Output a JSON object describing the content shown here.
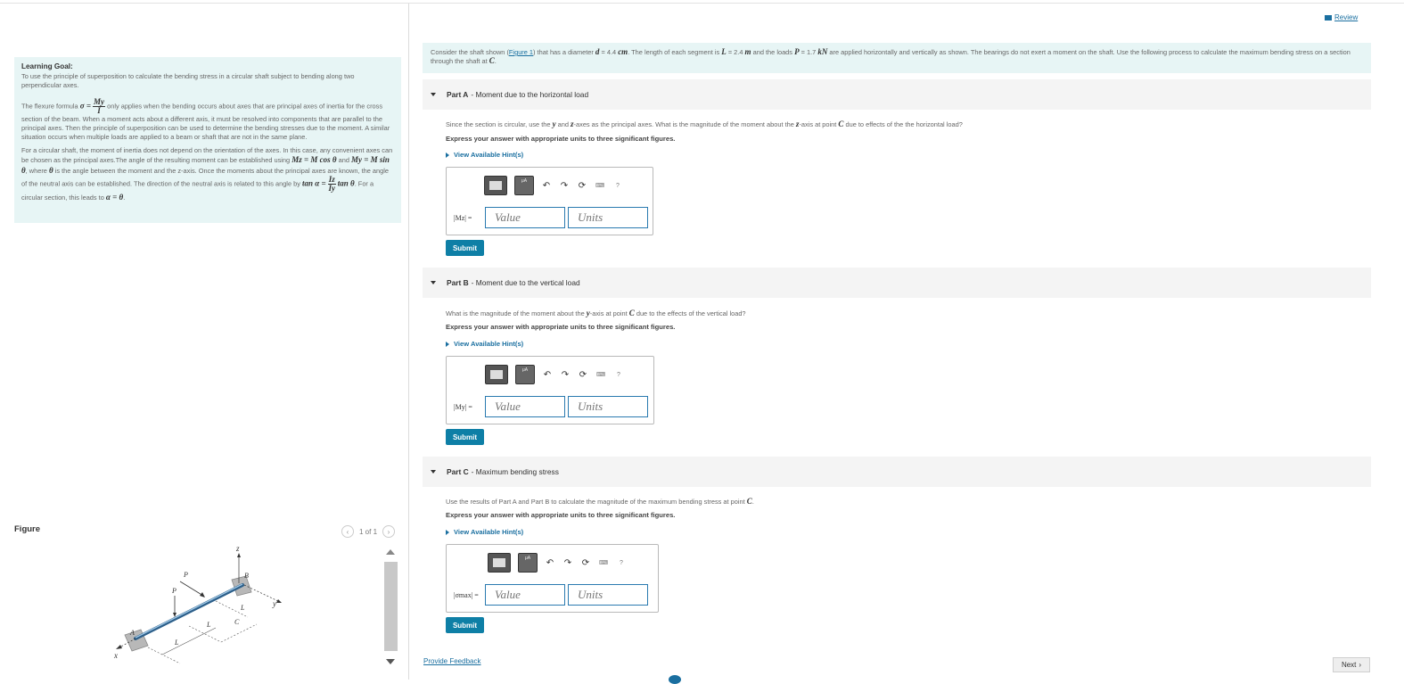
{
  "left": {
    "goal_title": "Learning Goal:",
    "goal_text": "To use the principle of superposition to calculate the bending stress in a circular shaft subject to bending along two perpendicular axes.",
    "para1_a": "The flexure formula",
    "para1_sigma": "σ =",
    "para1_num": "My",
    "para1_den": "I",
    "para1_b": "only applies when the bending occurs about axes that are principal axes of inertia for the cross section of the beam. When a moment acts about a different axis, it must be resolved into components that are parallel to the principal axes. Then the principle of superposition can be used to determine the bending stresses due to the moment. A similar situation occurs when multiple loads are applied to a beam or shaft that are not in the same plane.",
    "para2_a": "For a circular shaft, the moment of inertia does not depend on the orientation of the axes. In this case, any convenient axes can be chosen as the principal axes.The angle of the resulting moment can be established using",
    "para2_mz": "Mz = M cos θ",
    "para2_and": "and",
    "para2_my": "My = M sin θ",
    "para2_b": ", where",
    "para2_theta": "θ",
    "para2_c": "is the angle between the moment and the z-axis.  Once the moments about the principal axes are known, the angle of the neutral axis can be established. The direction of the neutral axis is related to this angle by",
    "para2_tan": "tan α =",
    "para2_num": "Iz",
    "para2_den": "Iy",
    "para2_tan2": "tan θ",
    "para2_d": ". For a circular section, this leads to",
    "para2_eq": "α = θ",
    "para2_end": ".",
    "figure_label": "Figure",
    "figure_page": "1 of 1",
    "figure_labels": {
      "z": "z",
      "B": "B",
      "P1": "P",
      "P2": "P",
      "y": "y",
      "L1": "L",
      "L2": "L",
      "L3": "L",
      "C": "C",
      "A": "A",
      "x": "x"
    }
  },
  "right": {
    "review_label": "Review",
    "intro_a": "Consider the shaft shown (",
    "intro_link": "Figure 1",
    "intro_b": ") that has a diameter",
    "intro_d": "d",
    "intro_c": "= 4.4",
    "intro_cm": "cm",
    "intro_e": ". The length of each segment is",
    "intro_L": "L",
    "intro_f": "= 2.4",
    "intro_m": "m",
    "intro_g": "and the loads",
    "intro_P": "P",
    "intro_h": "= 1.7",
    "intro_kN": "kN",
    "intro_i": "are applied horizontally and vertically as shown. The bearings do not exert a moment on the shaft. Use the following process to calculate the maximum bending stress on a section through the shaft at",
    "intro_C": "C",
    "intro_end": ".",
    "parts": [
      {
        "title_bold": "Part A",
        "title_rest": "- Moment due to the horizontal load",
        "question_a": "Since the section is circular, use the",
        "question_y": "y",
        "question_b": "and",
        "question_z": "z",
        "question_c": "-axes as the principal axes. What is the magnitude of the moment about the",
        "question_z2": "z",
        "question_d": "-axis at point",
        "question_C": "C",
        "question_e": "due to effects of the the horizontal load?",
        "instruction": "Express your answer with appropriate units to three significant figures.",
        "hint": "View Available Hint(s)",
        "answer_label": "|Mz| =",
        "value_placeholder": "Value",
        "units_placeholder": "Units",
        "submit": "Submit"
      },
      {
        "title_bold": "Part B",
        "title_rest": "- Moment due to the vertical load",
        "question_a": "What is the magnitude of the moment about the",
        "question_y": "y",
        "question_c": "-axis at point",
        "question_C": "C",
        "question_e": "due to the effects of the vertical load?",
        "instruction": "Express your answer with appropriate units to three significant figures.",
        "hint": "View Available Hint(s)",
        "answer_label": "|My| =",
        "value_placeholder": "Value",
        "units_placeholder": "Units",
        "submit": "Submit"
      },
      {
        "title_bold": "Part C",
        "title_rest": "- Maximum bending stress",
        "question_a": "Use the results of Part A and Part B to calculate the magnitude of the maximum bending stress at point",
        "question_C": "C",
        "question_e": ".",
        "instruction": "Express your answer with appropriate units to three significant figures.",
        "hint": "View Available Hint(s)",
        "answer_label": "|σmax| =",
        "value_placeholder": "Value",
        "units_placeholder": "Units",
        "submit": "Submit"
      }
    ],
    "toolbar_symbol": "μA",
    "toolbar_help": "?",
    "feedback": "Provide Feedback",
    "next": "Next"
  },
  "colors": {
    "accent": "#0e7fa6",
    "link": "#1a6fa0",
    "info_bg": "#e7f5f5"
  }
}
